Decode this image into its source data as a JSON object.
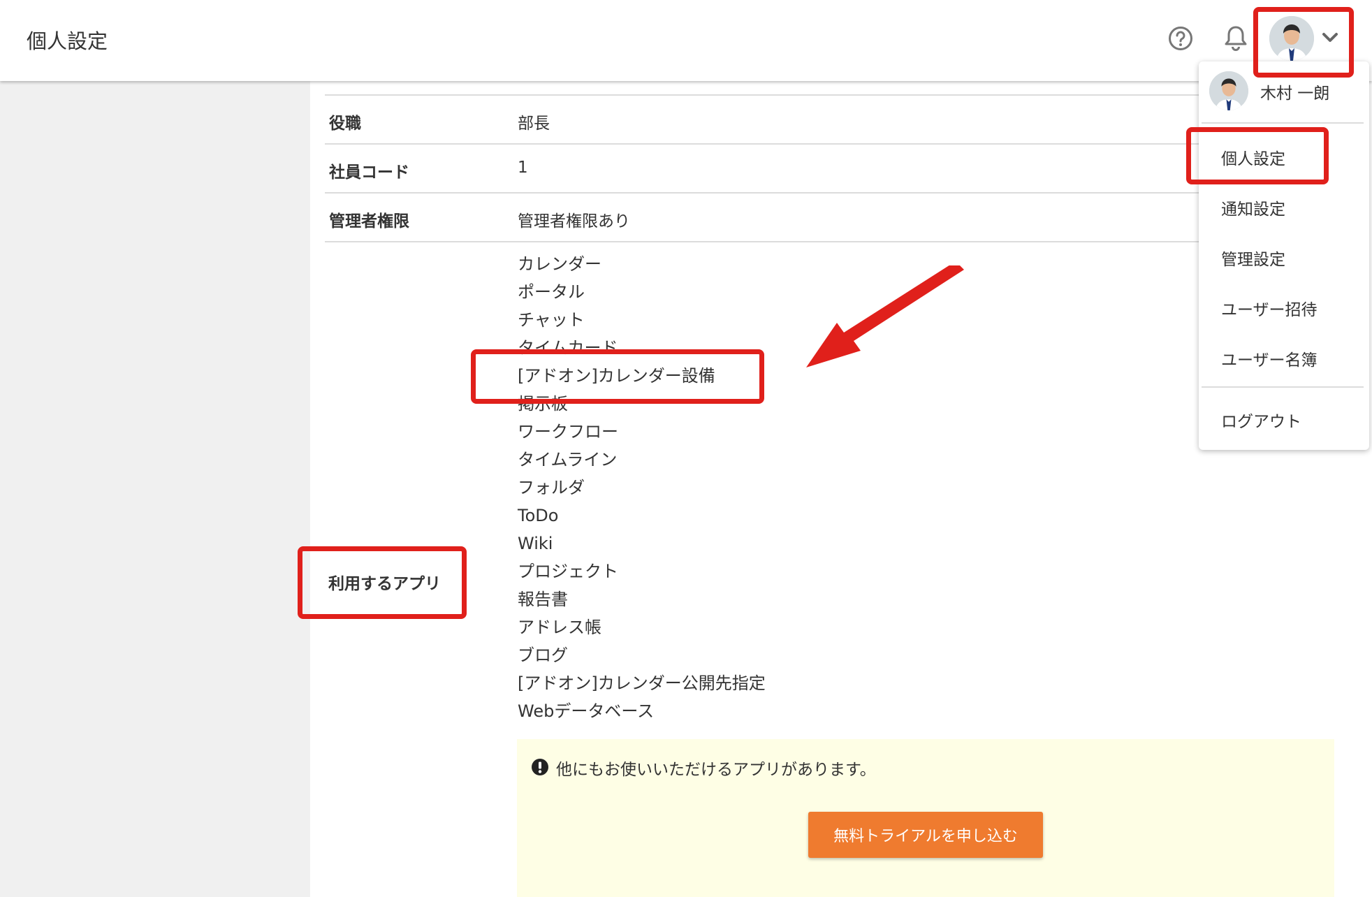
{
  "header": {
    "title": "個人設定"
  },
  "icons": {
    "help": "help-circle-icon",
    "bell": "bell-icon",
    "chevron": "chevron-down-icon",
    "notice": "exclamation-circle-icon"
  },
  "profile_rows": [
    {
      "label": "役職",
      "value": "部長"
    },
    {
      "label": "社員コード",
      "value": "1"
    },
    {
      "label": "管理者権限",
      "value": "管理者権限あり"
    }
  ],
  "apps": {
    "label": "利用するアプリ",
    "items": [
      "カレンダー",
      "ポータル",
      "チャット",
      "タイムカード",
      "[アドオン]カレンダー設備",
      "掲示板",
      "ワークフロー",
      "タイムライン",
      "フォルダ",
      "ToDo",
      "Wiki",
      "プロジェクト",
      "報告書",
      "アドレス帳",
      "ブログ",
      "[アドオン]カレンダー公開先指定",
      "Webデータベース"
    ]
  },
  "notice": {
    "text": "他にもお使いいただけるアプリがあります。",
    "button_label": "無料トライアルを申し込む"
  },
  "user_menu": {
    "user_name": "木村 一朗",
    "items": [
      {
        "label": "個人設定"
      },
      {
        "label": "通知設定"
      },
      {
        "label": "管理設定"
      },
      {
        "label": "ユーザー招待"
      },
      {
        "label": "ユーザー名簿"
      },
      {
        "label": "ログアウト"
      }
    ]
  },
  "colors": {
    "accent_orange": "#ef7b2f",
    "highlight_red": "#e0201b",
    "notice_bg": "#fefee5"
  }
}
